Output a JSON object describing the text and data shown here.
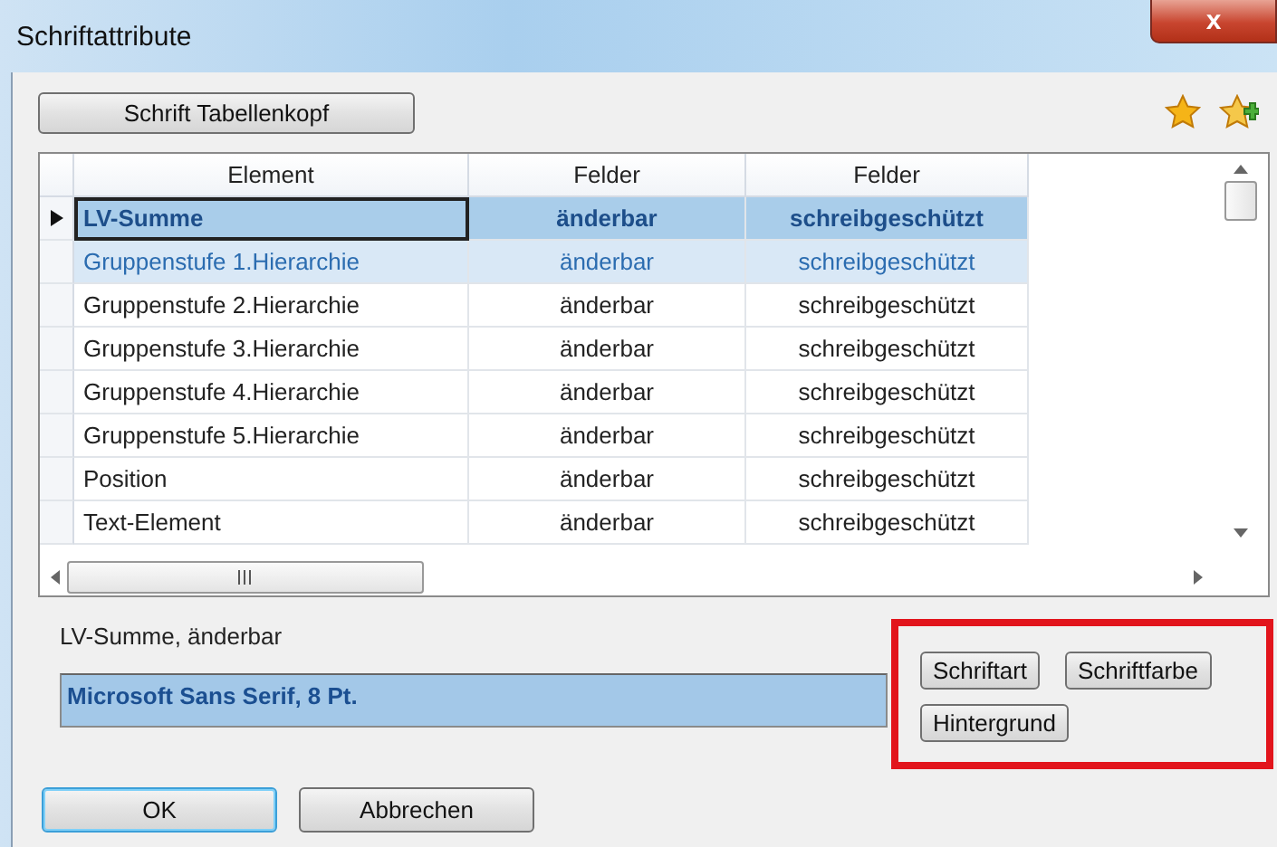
{
  "window": {
    "title": "Schriftattribute",
    "close": "x"
  },
  "header_button": "Schrift Tabellenkopf",
  "table": {
    "columns": [
      "Element",
      "Felder",
      "Felder"
    ],
    "rows": [
      {
        "cells": [
          "LV-Summe",
          "änderbar",
          "schreibgeschützt"
        ],
        "current": true,
        "selected": true
      },
      {
        "cells": [
          "Gruppenstufe 1.Hierarchie",
          "änderbar",
          "schreibgeschützt"
        ],
        "current": false,
        "selected": true
      },
      {
        "cells": [
          "Gruppenstufe 2.Hierarchie",
          "änderbar",
          "schreibgeschützt"
        ],
        "current": false,
        "selected": false
      },
      {
        "cells": [
          "Gruppenstufe 3.Hierarchie",
          "änderbar",
          "schreibgeschützt"
        ],
        "current": false,
        "selected": false
      },
      {
        "cells": [
          "Gruppenstufe 4.Hierarchie",
          "änderbar",
          "schreibgeschützt"
        ],
        "current": false,
        "selected": false
      },
      {
        "cells": [
          "Gruppenstufe 5.Hierarchie",
          "änderbar",
          "schreibgeschützt"
        ],
        "current": false,
        "selected": false
      },
      {
        "cells": [
          "Position",
          "änderbar",
          "schreibgeschützt"
        ],
        "current": false,
        "selected": false
      },
      {
        "cells": [
          "Text-Element",
          "änderbar",
          "schreibgeschützt"
        ],
        "current": false,
        "selected": false
      }
    ]
  },
  "selection_label": "LV-Summe, änderbar",
  "font_preview": "Microsoft Sans Serif, 8 Pt.",
  "style_buttons": [
    "Schriftart",
    "Schriftfarbe",
    "Hintergrund"
  ],
  "buttons": [
    {
      "label": "OK",
      "default": true
    },
    {
      "label": "Abbrechen",
      "default": false
    }
  ]
}
